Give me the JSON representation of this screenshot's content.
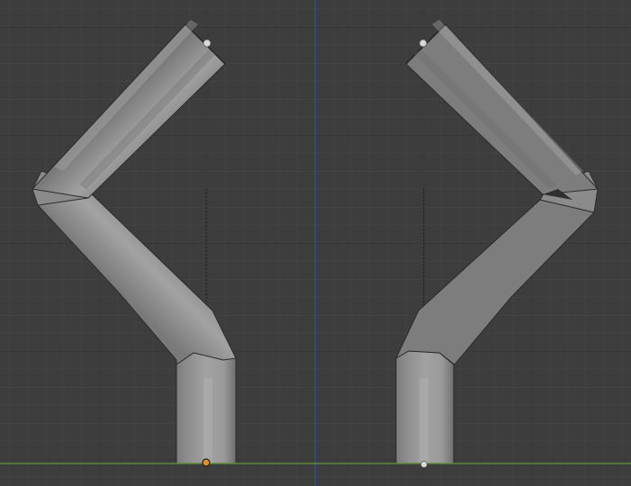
{
  "viewport": {
    "name": "3d-viewport",
    "background_color": "#3d3d3d",
    "minor_grid_color": "#444444",
    "major_grid_color": "#2f2f2f",
    "z_axis_color": "#2b4f8f",
    "x_axis_color": "#5e8a36"
  },
  "objects": [
    {
      "name": "bent-pipe-left",
      "color": "#9a9a9a",
      "edge_color": "#2a2a2a"
    },
    {
      "name": "bent-pipe-right",
      "color": "#9a9a9a",
      "edge_color": "#2a2a2a"
    }
  ],
  "markers": [
    {
      "name": "origin-point",
      "color": "#e0902a"
    },
    {
      "name": "vertex-points",
      "color": "#d8d8d8"
    }
  ]
}
